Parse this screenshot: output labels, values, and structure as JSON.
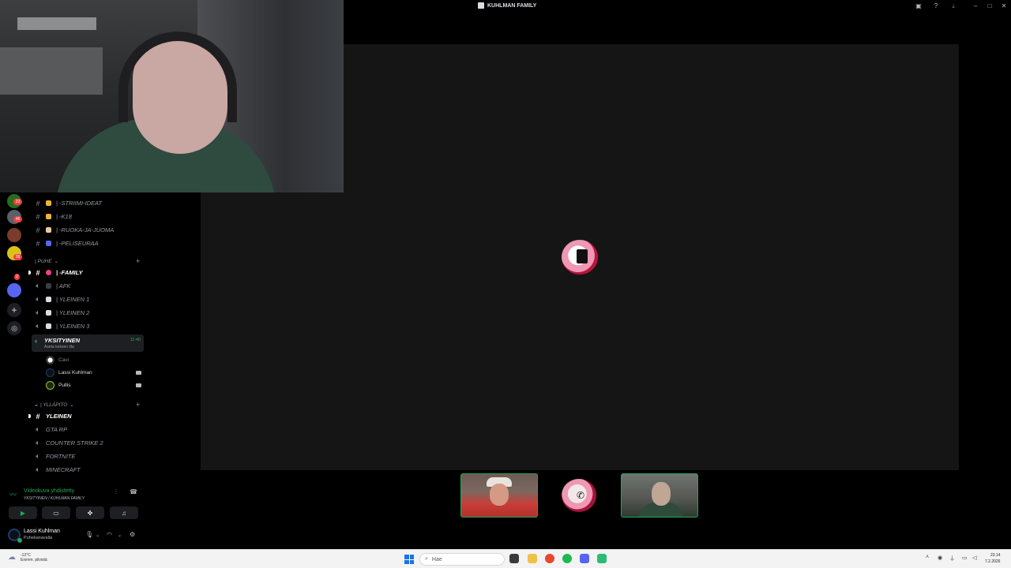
{
  "titlebar": {
    "title": "KUHLMAN FAMILY"
  },
  "server_rail": {
    "badges": [
      "23",
      "46",
      "26",
      "2"
    ]
  },
  "channels": [
    {
      "icon": "hash",
      "emoji_color": "#f0b232",
      "label": "| -STRIIMI-IDEAT"
    },
    {
      "icon": "hash",
      "emoji_color": "#f0b232",
      "label": "| -K18"
    },
    {
      "icon": "hash",
      "emoji_color": "#e8c9a0",
      "label": "| -RUOKA-JA-JUOMA"
    },
    {
      "icon": "hash",
      "emoji_color": "#5865f2",
      "label": "| -PELISEURAA"
    }
  ],
  "category_puhe": {
    "label": "| PUHE"
  },
  "family_channel": {
    "label": "| -FAMILY"
  },
  "voice_channels": [
    {
      "label": "| AFK"
    },
    {
      "label": "| YLEINEN 1"
    },
    {
      "label": "| YLEINEN 2"
    },
    {
      "label": "| YLEINEN 3"
    }
  ],
  "active_voice": {
    "name": "YKSITYINEN",
    "subtitle": "Aseta keksen tila",
    "time": "11:40"
  },
  "voice_users": [
    {
      "name": "Cavi",
      "muted": true
    },
    {
      "name": "Lassi Kuhlman",
      "muted": false
    },
    {
      "name": "Pullis",
      "muted": false
    }
  ],
  "category_yllapito": {
    "label": "| YLLÄPITO"
  },
  "yllapito_channels": [
    {
      "label": "YLEINEN",
      "bold": true,
      "type": "text"
    },
    {
      "label": "GTA RP",
      "bold": false,
      "type": "voice"
    },
    {
      "label": "COUNTER STRIKE 2",
      "bold": false,
      "type": "voice"
    },
    {
      "label": "FORTNITE",
      "bold": false,
      "type": "voice"
    },
    {
      "label": "MINECRAFT",
      "bold": false,
      "type": "voice"
    }
  ],
  "voice_panel": {
    "status": "Videokuva yhdistetty",
    "channel": "YKSITYINEN / KUHLMAN FAMILY"
  },
  "user_panel": {
    "name": "Lassi Kuhlman",
    "status": "Puhekanavalla"
  },
  "taskbar": {
    "temp": "-12°C",
    "weather": "Enimm. pilvistä",
    "search_placeholder": "Hae",
    "time": "23.14",
    "date": "7.2.2026"
  },
  "colors": {
    "accent_green": "#23a55a",
    "bg": "#000000",
    "stage": "#151516"
  }
}
